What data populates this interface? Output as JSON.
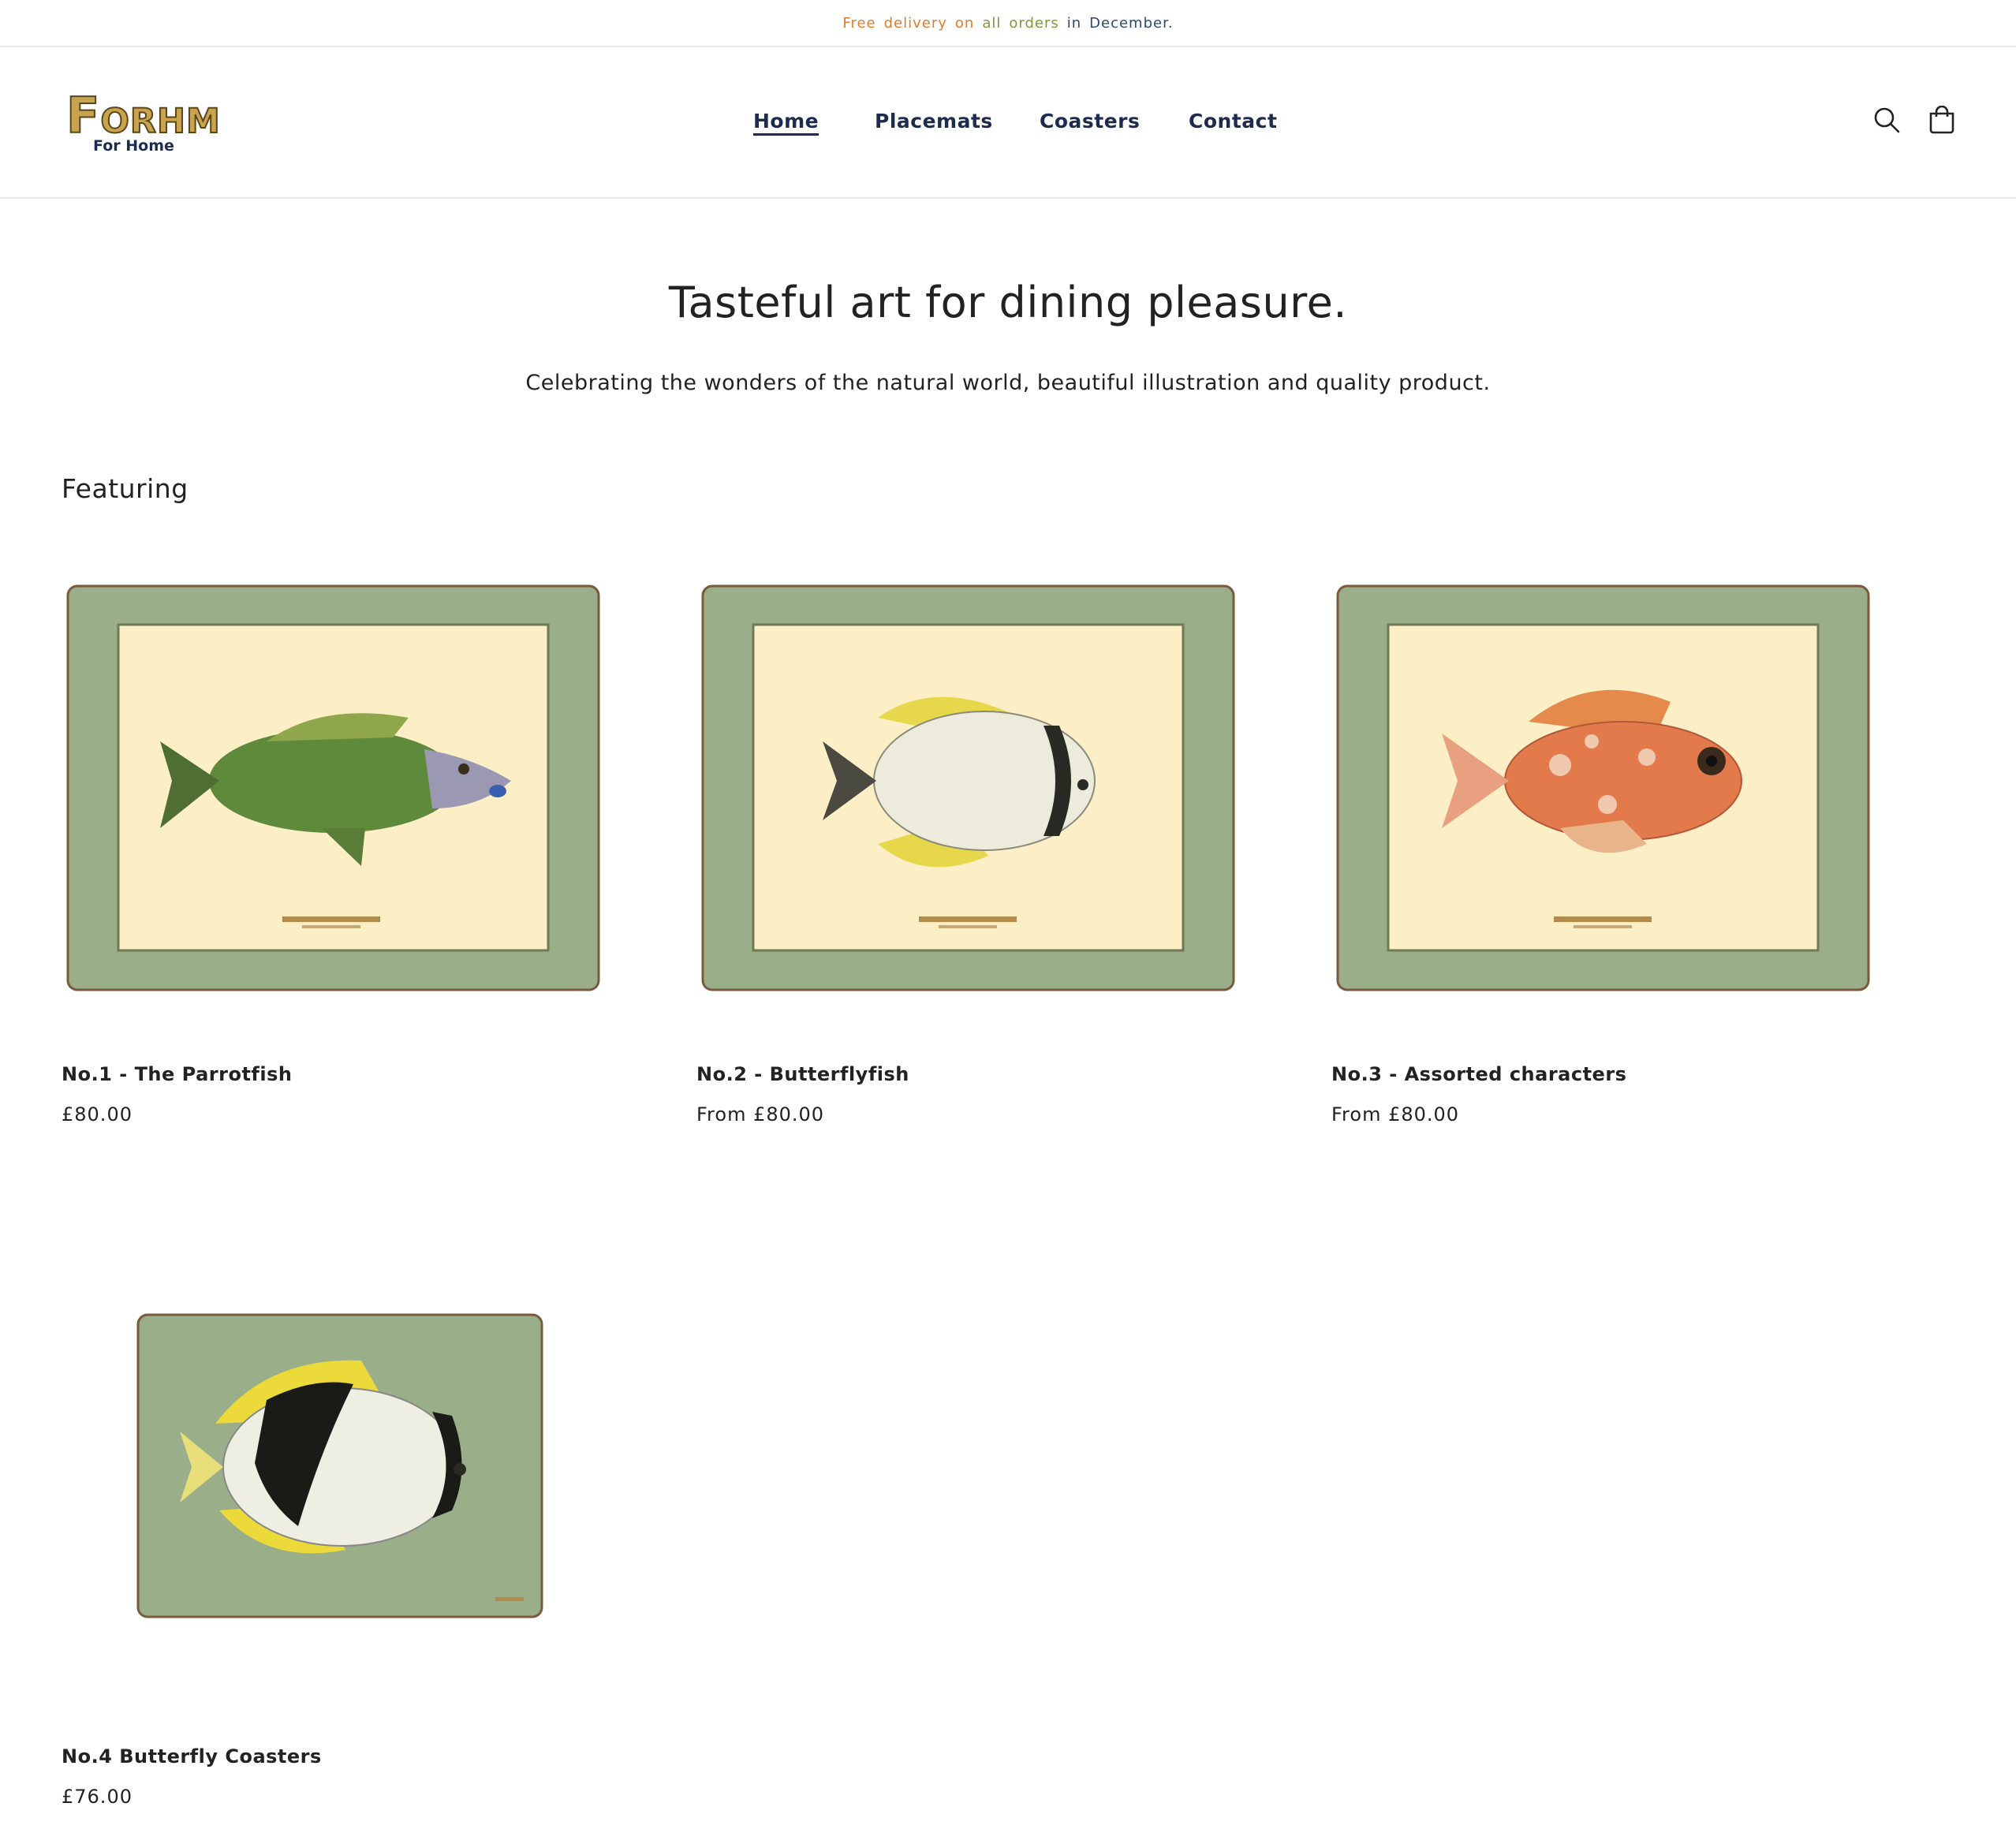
{
  "announcement": {
    "words": [
      {
        "text": "Free",
        "color": "#e07b2a"
      },
      {
        "text": "delivery",
        "color": "#e07b2a"
      },
      {
        "text": "on",
        "color": "#e07b2a"
      },
      {
        "text": "all",
        "color": "#7a9a3a"
      },
      {
        "text": "orders",
        "color": "#7a9a3a"
      },
      {
        "text": "in",
        "color": "#2d4a6e"
      },
      {
        "text": "December.",
        "color": "#2d4a6e"
      }
    ]
  },
  "header": {
    "logo_text": "Forhm",
    "logo_sub": "For Home",
    "nav": [
      {
        "label": "Home",
        "active": true
      },
      {
        "label": "Placemats",
        "active": false
      },
      {
        "label": "Coasters",
        "active": false
      },
      {
        "label": "Contact",
        "active": false
      }
    ],
    "icons": [
      "search-icon",
      "cart-icon"
    ]
  },
  "hero": {
    "title": "Tasteful art for dining pleasure.",
    "subtitle": "Celebrating the wonders of the natural world, beautiful illustration and quality product."
  },
  "featured": {
    "heading": "Featuring",
    "products": [
      {
        "name": "No.1 - The Parrotfish",
        "price": "£80.00"
      },
      {
        "name": "No.2 - Butterflyfish",
        "price": "From £80.00"
      },
      {
        "name": "No.3 - Assorted characters",
        "price": "From £80.00"
      },
      {
        "name": "No.4 Butterfly Coasters",
        "price": "£76.00"
      }
    ]
  },
  "colors": {
    "mat_green": "#9aae8a",
    "mat_cream": "#fcefc6",
    "mat_border": "#7a5a3c",
    "nav_text": "#1d2b4f",
    "logo_gold": "#c9a44f"
  }
}
